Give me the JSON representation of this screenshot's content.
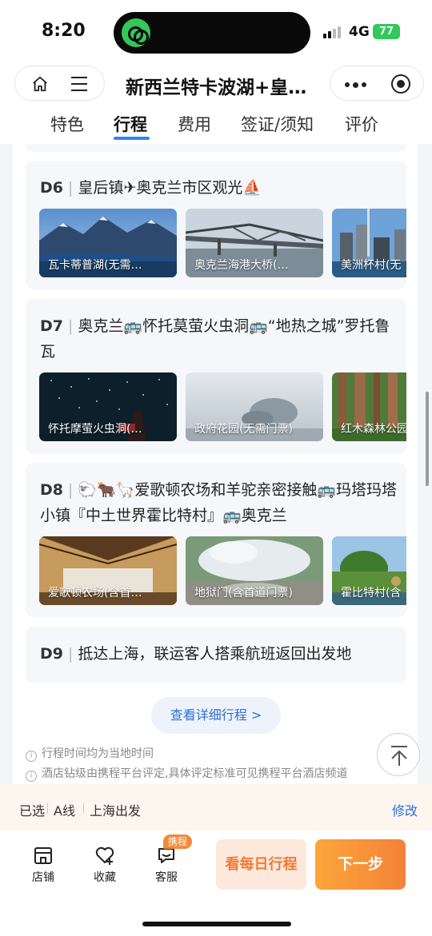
{
  "status_bar": {
    "time": "8:20",
    "network": "4G",
    "battery": "77"
  },
  "nav": {
    "title": "新西兰特卡波湖+皇…"
  },
  "tabs": [
    {
      "label": "特色"
    },
    {
      "label": "行程"
    },
    {
      "label": "费用"
    },
    {
      "label": "签证/须知"
    },
    {
      "label": "评价"
    }
  ],
  "active_tab": "行程",
  "days": [
    {
      "day": "D6",
      "title": "皇后镇✈奥克兰市区观光⛵",
      "spots": [
        {
          "label": "瓦卡蒂普湖(无需…"
        },
        {
          "label": "奥克兰海港大桥(…"
        },
        {
          "label": "美洲杯村(无"
        }
      ]
    },
    {
      "day": "D7",
      "title": "奥克兰🚌怀托莫萤火虫洞🚌“地热之城”罗托鲁瓦",
      "spots": [
        {
          "label": "怀托摩萤火虫洞(…"
        },
        {
          "label": "政府花园(无需门票)"
        },
        {
          "label": "红木森林公园"
        }
      ]
    },
    {
      "day": "D8",
      "title": "🐑🐂🦙爱歌顿农场和羊驼亲密接触🚌玛塔玛塔小镇『中土世界霍比特村』🚌奥克兰",
      "spots": [
        {
          "label": "爱歌顿农场(含首…"
        },
        {
          "label": "地狱门(含首道门票)"
        },
        {
          "label": "霍比特村(含"
        }
      ]
    },
    {
      "day": "D9",
      "title": "抵达上海，联运客人搭乘航班返回出发地",
      "spots": []
    }
  ],
  "detail_button": "查看详细行程 >",
  "notes": [
    "行程时间均为当地时间",
    "酒店钻级由携程平台评定,具体评定标准可见携程平台酒店频道"
  ],
  "selection": {
    "selected_label": "已选",
    "line": "A线",
    "departure": "上海出发",
    "modify": "修改"
  },
  "bottom_bar": {
    "store": "店铺",
    "favorite": "收藏",
    "service": "客服",
    "service_badge": "携程",
    "daily_itinerary": "看每日行程",
    "next_step": "下一步"
  },
  "colors": {
    "accent_blue": "#2e86f5",
    "orange": "#f3823a",
    "card_bg": "#f5f7fa"
  }
}
